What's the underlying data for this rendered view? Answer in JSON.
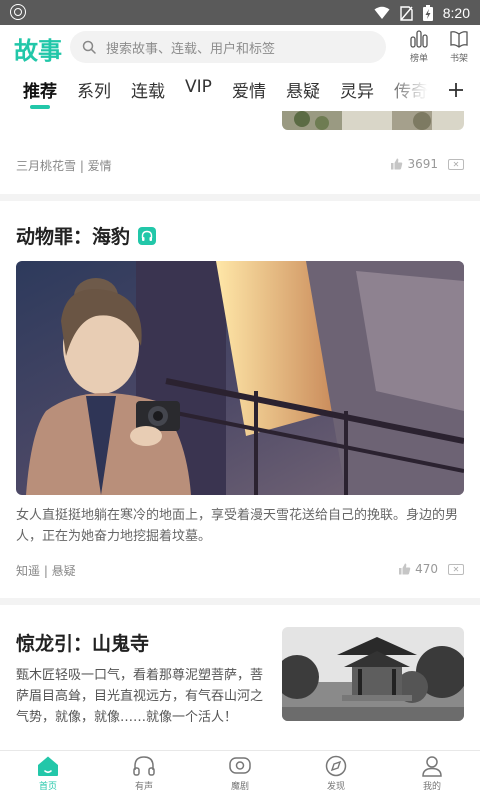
{
  "status_bar": {
    "time": "8:20"
  },
  "header": {
    "logo": "故事",
    "search_placeholder": "搜索故事、连载、用户和标签",
    "ranking_label": "榜单",
    "bookshelf_label": "书架"
  },
  "tabs": [
    {
      "label": "推荐",
      "active": true
    },
    {
      "label": "系列"
    },
    {
      "label": "连载"
    },
    {
      "label": "VIP"
    },
    {
      "label": "爱情"
    },
    {
      "label": "悬疑"
    },
    {
      "label": "灵异"
    },
    {
      "label": "传奇"
    }
  ],
  "feed": [
    {
      "meta": "三月桃花雪 | 爱情",
      "likes": "3691"
    },
    {
      "title": "动物罪：海豹",
      "has_audio": true,
      "description": "女人直挺挺地躺在寒冷的地面上，享受着漫天雪花送给自己的挽联。身边的男人，正在为她奋力地挖掘着坟墓。",
      "meta": "知遥 | 悬疑",
      "likes": "470"
    },
    {
      "title": "惊龙引：山鬼寺",
      "description": "甄木匠轻吸一口气，看着那尊泥塑菩萨，菩萨眉目高耸，目光直视远方，有气吞山河之气势，就像，就像……就像一个活人！"
    }
  ],
  "bottom_nav": [
    {
      "label": "首页",
      "active": true
    },
    {
      "label": "有声"
    },
    {
      "label": "魔剧"
    },
    {
      "label": "发现"
    },
    {
      "label": "我的"
    }
  ],
  "colors": {
    "accent": "#22c7a9",
    "status_bar": "#5a5a5a"
  }
}
